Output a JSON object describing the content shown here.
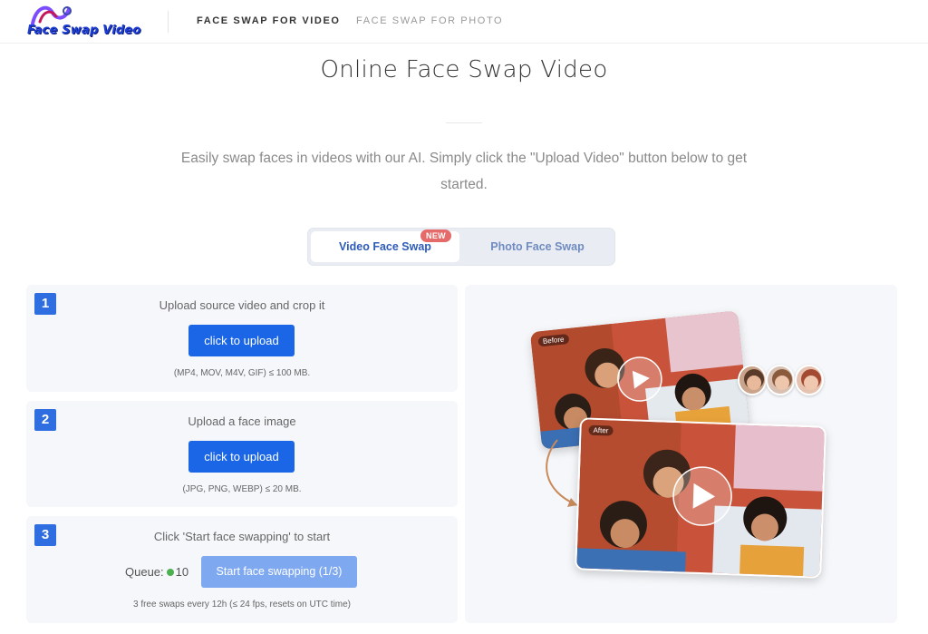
{
  "header": {
    "logo_text": "Face Swap Video",
    "nav": [
      {
        "label": "FACE SWAP FOR VIDEO"
      },
      {
        "label": "FACE SWAP FOR PHOTO"
      }
    ]
  },
  "hero": {
    "title": "Online Face Swap Video",
    "subtitle": "Easily swap faces in videos with our AI. Simply click the \"Upload Video\" button below to get started."
  },
  "tabs": {
    "video_label": "Video Face Swap",
    "photo_label": "Photo Face Swap",
    "new_badge": "NEW"
  },
  "steps": [
    {
      "number": "1",
      "title": "Upload source video and crop it",
      "button": "click to upload",
      "note": "(MP4, MOV, M4V, GIF) ≤ 100 MB."
    },
    {
      "number": "2",
      "title": "Upload a face image",
      "button": "click to upload",
      "note": "(JPG, PNG, WEBP) ≤ 20 MB."
    },
    {
      "number": "3",
      "title": "Click 'Start face swapping' to start",
      "queue_label": "Queue:",
      "queue_count": "10",
      "button": "Start face swapping (1/3)",
      "note": "3 free swaps every 12h (≤ 24 fps, resets on UTC time)"
    }
  ],
  "preview": {
    "before_label": "Before",
    "after_label": "After"
  },
  "colors": {
    "primary": "#1a66e6",
    "step_number": "#2f6ee0",
    "disabled_button": "#7ea8f0",
    "badge": "#e56b6b",
    "queue_status": "#4caf50"
  }
}
